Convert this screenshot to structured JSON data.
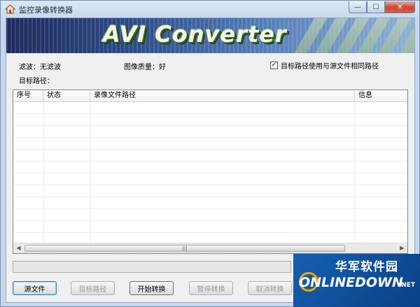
{
  "window": {
    "title": "监控录像转换器",
    "min_label": "—",
    "max_label": "☐",
    "close_label": "✕"
  },
  "banner": {
    "title": "AVI Converter"
  },
  "settings": {
    "filter_label": "滤波：无滤波",
    "quality_label": "图像质量：好",
    "same_path_label": "目标路径使用与源文件相同路径",
    "same_path_checked": "✓",
    "target_path_label": "目标路径："
  },
  "table": {
    "columns": [
      "序号",
      "状态",
      "录像文件路径",
      "信息"
    ],
    "rows": [],
    "scroll_thumb": "|||",
    "scroll_left": "◀",
    "scroll_right": "▶"
  },
  "progress": {
    "value": 0
  },
  "buttons": {
    "source_file": "源文件",
    "target_path": "目标路径",
    "start": "开始转换",
    "pause": "暂停转换",
    "cancel": "取消转换"
  },
  "watermark": {
    "cn": "华军软件园",
    "en": "ONLINEDOWN",
    "net": ".NET"
  },
  "colors": {
    "progress_fill": "#5cbd3c",
    "watermark_bg": "#1560b0"
  }
}
